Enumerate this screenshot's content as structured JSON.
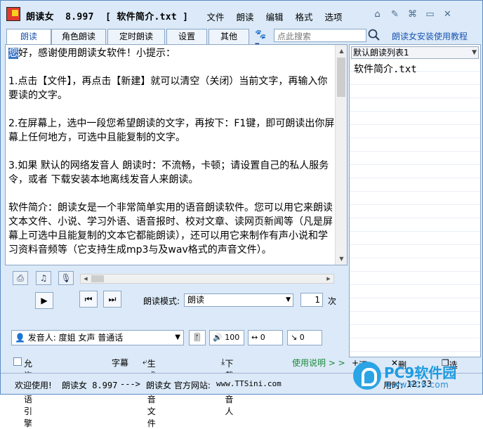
{
  "app": {
    "name": "朗读女",
    "version": "8.997",
    "file": "[ 软件简介.txt ]"
  },
  "menu": [
    "文件",
    "朗读",
    "编辑",
    "格式",
    "选项"
  ],
  "window_icons": [
    "home-icon",
    "tools-icon",
    "tree-icon",
    "minimize-icon",
    "close-icon"
  ],
  "tabs": [
    "朗读",
    "角色朗读",
    "定时朗读",
    "设置",
    "其他"
  ],
  "search": {
    "placeholder": "点此搜索"
  },
  "guide_link": "朗读女安装使用教程",
  "editor": {
    "selected_char": "您",
    "text": "好，感谢使用朗读女软件！小提示：\n\n1.点击【文件】，再点击【新建】就可以清空（关闭）当前文字，再输入你要读的文字。\n\n2.在屏幕上，选中一段您希望朗读的文字，再按下：F1键，即可朗读出你屏幕上任何地方，可选中且能复制的文字。\n\n3.如果 默认的网络发音人 朗读时：不流畅，卡顿；请设置自己的私人服务令，或者 下载安装本地离线发音人来朗读。\n\n软件简介：朗读女是一个非常简单实用的语音朗读软件。您可以用它来朗读文本文件、小说、学习外语、语音报时、校对文章、读网页新闻等（凡是屏幕上可选中且能复制的文本它都能朗读），还可以用它来制作有声小说和学习资料音频等（它支持生成mp3与及wav格式的声音文件）。"
  },
  "playlist": {
    "name": "默认朗读列表1",
    "items": [
      "软件简介.txt"
    ]
  },
  "list_footer": {
    "add": "添加",
    "delete": "删除",
    "options": "选项"
  },
  "controls": {
    "mode_label": "朗读模式:",
    "mode_value": "朗读",
    "times_value": "1",
    "times_unit": "次",
    "voice_label": "发音人:",
    "voice_value": "度姐 女声 普通话",
    "volume": "100",
    "speed": "0",
    "pitch": "0"
  },
  "bottom": {
    "allow_dual": "允许双语引擎",
    "subtitle": "字幕",
    "gen_audio": "生成声音文件",
    "download_voice": "下载发音人",
    "help": "使用说明 > >"
  },
  "status": {
    "welcome": "欢迎使用!",
    "app": "朗读女 8.997",
    "arrow": "--->",
    "site_label": "朗读女 官方网站:",
    "site_url": "www.TTSini.com",
    "time_label": "用时:",
    "time_value": "12:33"
  },
  "watermark": {
    "brand": "PC9软件园",
    "url": "www.PC9.com"
  }
}
